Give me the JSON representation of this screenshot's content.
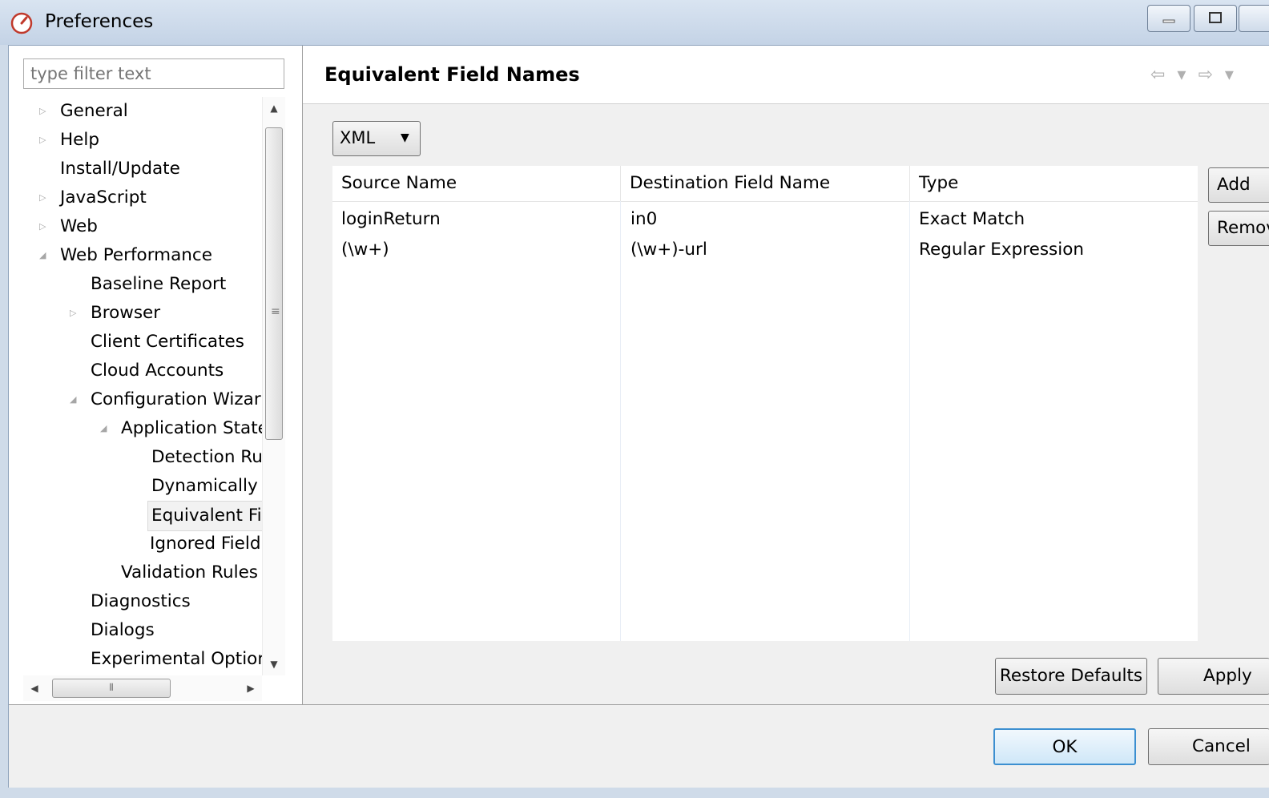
{
  "window": {
    "title": "Preferences"
  },
  "filter": {
    "placeholder": "type filter text"
  },
  "tree": [
    {
      "label": "General",
      "arrow": "▷"
    },
    {
      "label": "Help",
      "arrow": "▷"
    },
    {
      "label": "Install/Update",
      "arrow": ""
    },
    {
      "label": "JavaScript",
      "arrow": "▷"
    },
    {
      "label": "Web",
      "arrow": "▷"
    },
    {
      "label": "Web Performance",
      "arrow": "◢"
    },
    {
      "label": "Baseline Report",
      "arrow": ""
    },
    {
      "label": "Browser",
      "arrow": "▷"
    },
    {
      "label": "Client Certificates",
      "arrow": ""
    },
    {
      "label": "Cloud Accounts",
      "arrow": ""
    },
    {
      "label": "Configuration Wizar",
      "arrow": "◢"
    },
    {
      "label": "Application State",
      "arrow": "◢"
    },
    {
      "label": "Detection Ru",
      "arrow": ""
    },
    {
      "label": "Dynamically",
      "arrow": ""
    },
    {
      "label": "Equivalent Fi",
      "arrow": ""
    },
    {
      "label": "Ignored Field",
      "arrow": ""
    },
    {
      "label": "Validation Rules",
      "arrow": ""
    },
    {
      "label": "Diagnostics",
      "arrow": ""
    },
    {
      "label": "Dialogs",
      "arrow": ""
    },
    {
      "label": "Experimental Optior",
      "arrow": ""
    }
  ],
  "page": {
    "title": "Equivalent Field Names",
    "nav": "⇦ ▾ ⇨ ▾",
    "format": "XML",
    "columns": [
      "Source Name",
      "Destination Field Name",
      "Type"
    ],
    "rows": [
      [
        "loginReturn",
        "in0",
        "Exact Match"
      ],
      [
        "(\\w+)",
        "(\\w+)-url",
        "Regular Expression"
      ]
    ],
    "add_label": "Add",
    "remove_label": "Remove",
    "restore_label": "Restore Defaults",
    "apply_label": "Apply"
  },
  "dialog": {
    "ok_label": "OK",
    "cancel_label": "Cancel"
  }
}
